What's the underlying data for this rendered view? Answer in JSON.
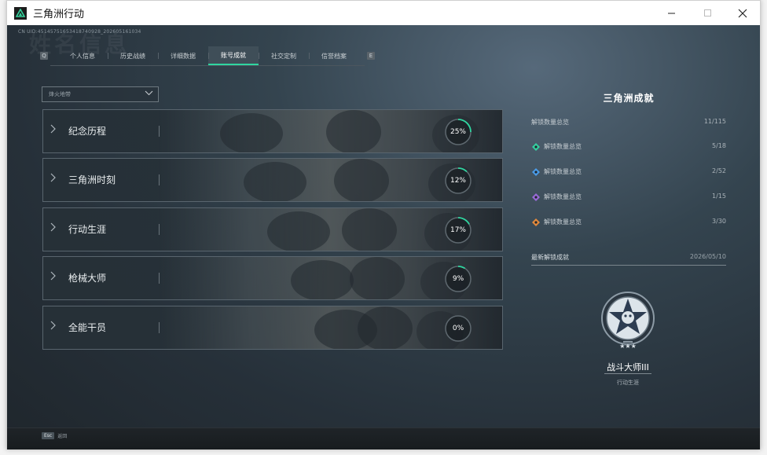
{
  "window": {
    "title": "三角洲行动"
  },
  "header": {
    "uid": "CN UID:451457516534187409​28_202605161034",
    "bg_word": "姓名信息"
  },
  "tabs": [
    {
      "label": "个人信息"
    },
    {
      "label": "历史战绩"
    },
    {
      "label": "详细数据"
    },
    {
      "label": "账号成就",
      "active": true
    },
    {
      "label": "社交定制"
    },
    {
      "label": "信誉档案"
    }
  ],
  "filter": {
    "value": "烽火地带"
  },
  "categories": [
    {
      "label": "纪念历程",
      "percent": "25%",
      "progress": 0.25
    },
    {
      "label": "三角洲时刻",
      "percent": "12%",
      "progress": 0.12
    },
    {
      "label": "行动生涯",
      "percent": "17%",
      "progress": 0.17
    },
    {
      "label": "枪械大师",
      "percent": "9%",
      "progress": 0.09
    },
    {
      "label": "全能干员",
      "percent": "0%",
      "progress": 0.0
    }
  ],
  "summary": {
    "title": "三角洲成就",
    "total": {
      "label": "解锁数量总览",
      "value": "11/115"
    },
    "rows": [
      {
        "label": "解锁数量总览",
        "value": "5/18",
        "icon": "green-rank-icon",
        "color": "#34d0a0"
      },
      {
        "label": "解锁数量总览",
        "value": "2/52",
        "icon": "blue-rank-icon",
        "color": "#4a9be8"
      },
      {
        "label": "解锁数量总览",
        "value": "1/15",
        "icon": "purple-rank-icon",
        "color": "#9a6ad8"
      },
      {
        "label": "解锁数量总览",
        "value": "3/30",
        "icon": "orange-rank-icon",
        "color": "#e48a3c"
      }
    ]
  },
  "latest": {
    "label": "最新解锁成就",
    "date": "2026/05/10"
  },
  "medal": {
    "name": "战斗大师III",
    "category": "行动生涯"
  },
  "footer": {
    "esc_key": "Esc",
    "esc_label": "返回"
  },
  "colors": {
    "accent": "#2fd6a0"
  }
}
